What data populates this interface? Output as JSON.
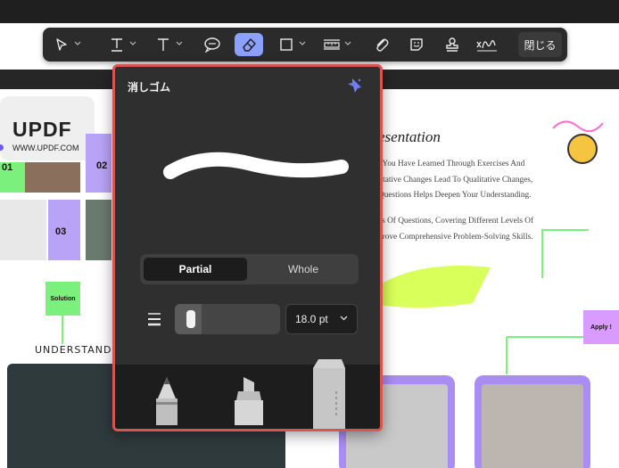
{
  "toolbar": {
    "tools": [
      {
        "name": "select",
        "icon": "cursor-icon",
        "dropdown": true
      },
      {
        "name": "text-underline",
        "icon": "underlined-text-icon",
        "dropdown": true
      },
      {
        "name": "text",
        "icon": "text-icon",
        "dropdown": true
      },
      {
        "name": "comment",
        "icon": "comment-icon",
        "dropdown": false
      },
      {
        "name": "eraser",
        "icon": "eraser-icon",
        "dropdown": false,
        "active": true
      },
      {
        "name": "shape",
        "icon": "rectangle-icon",
        "dropdown": true
      },
      {
        "name": "measure",
        "icon": "ruler-icon",
        "dropdown": true
      },
      {
        "name": "attachment",
        "icon": "paperclip-icon",
        "dropdown": false
      },
      {
        "name": "sticker",
        "icon": "sticker-icon",
        "dropdown": false
      },
      {
        "name": "stamp",
        "icon": "stamp-icon",
        "dropdown": false
      },
      {
        "name": "signature",
        "icon": "signature-icon",
        "dropdown": false
      }
    ],
    "close_label": "閉じる"
  },
  "eraser_panel": {
    "title": "消しゴム",
    "mode_options": [
      "Partial",
      "Whole"
    ],
    "selected_mode": "Partial",
    "size_value": "18.0 pt",
    "accent_color": "#8ba0ff",
    "border_color": "#d9534f"
  },
  "document": {
    "logo": "UPDF",
    "logo_url": "WWW.UPDF.COM",
    "tile_numbers": [
      "01",
      "02",
      "03"
    ],
    "solution_label": "Solution",
    "understand_label": "UNDERSTAND R",
    "heading_fragment": "esentation",
    "para1": [
      "t You Have Learned Through Exercises And",
      "titative Changes Lead To Qualitative Changes,",
      "Questions Helps Deepen Your Understanding."
    ],
    "para2": [
      "es Of Questions, Covering Different Levels Of",
      "prove Comprehensive Problem-Solving Skills."
    ],
    "apply_label": "Apply !"
  }
}
